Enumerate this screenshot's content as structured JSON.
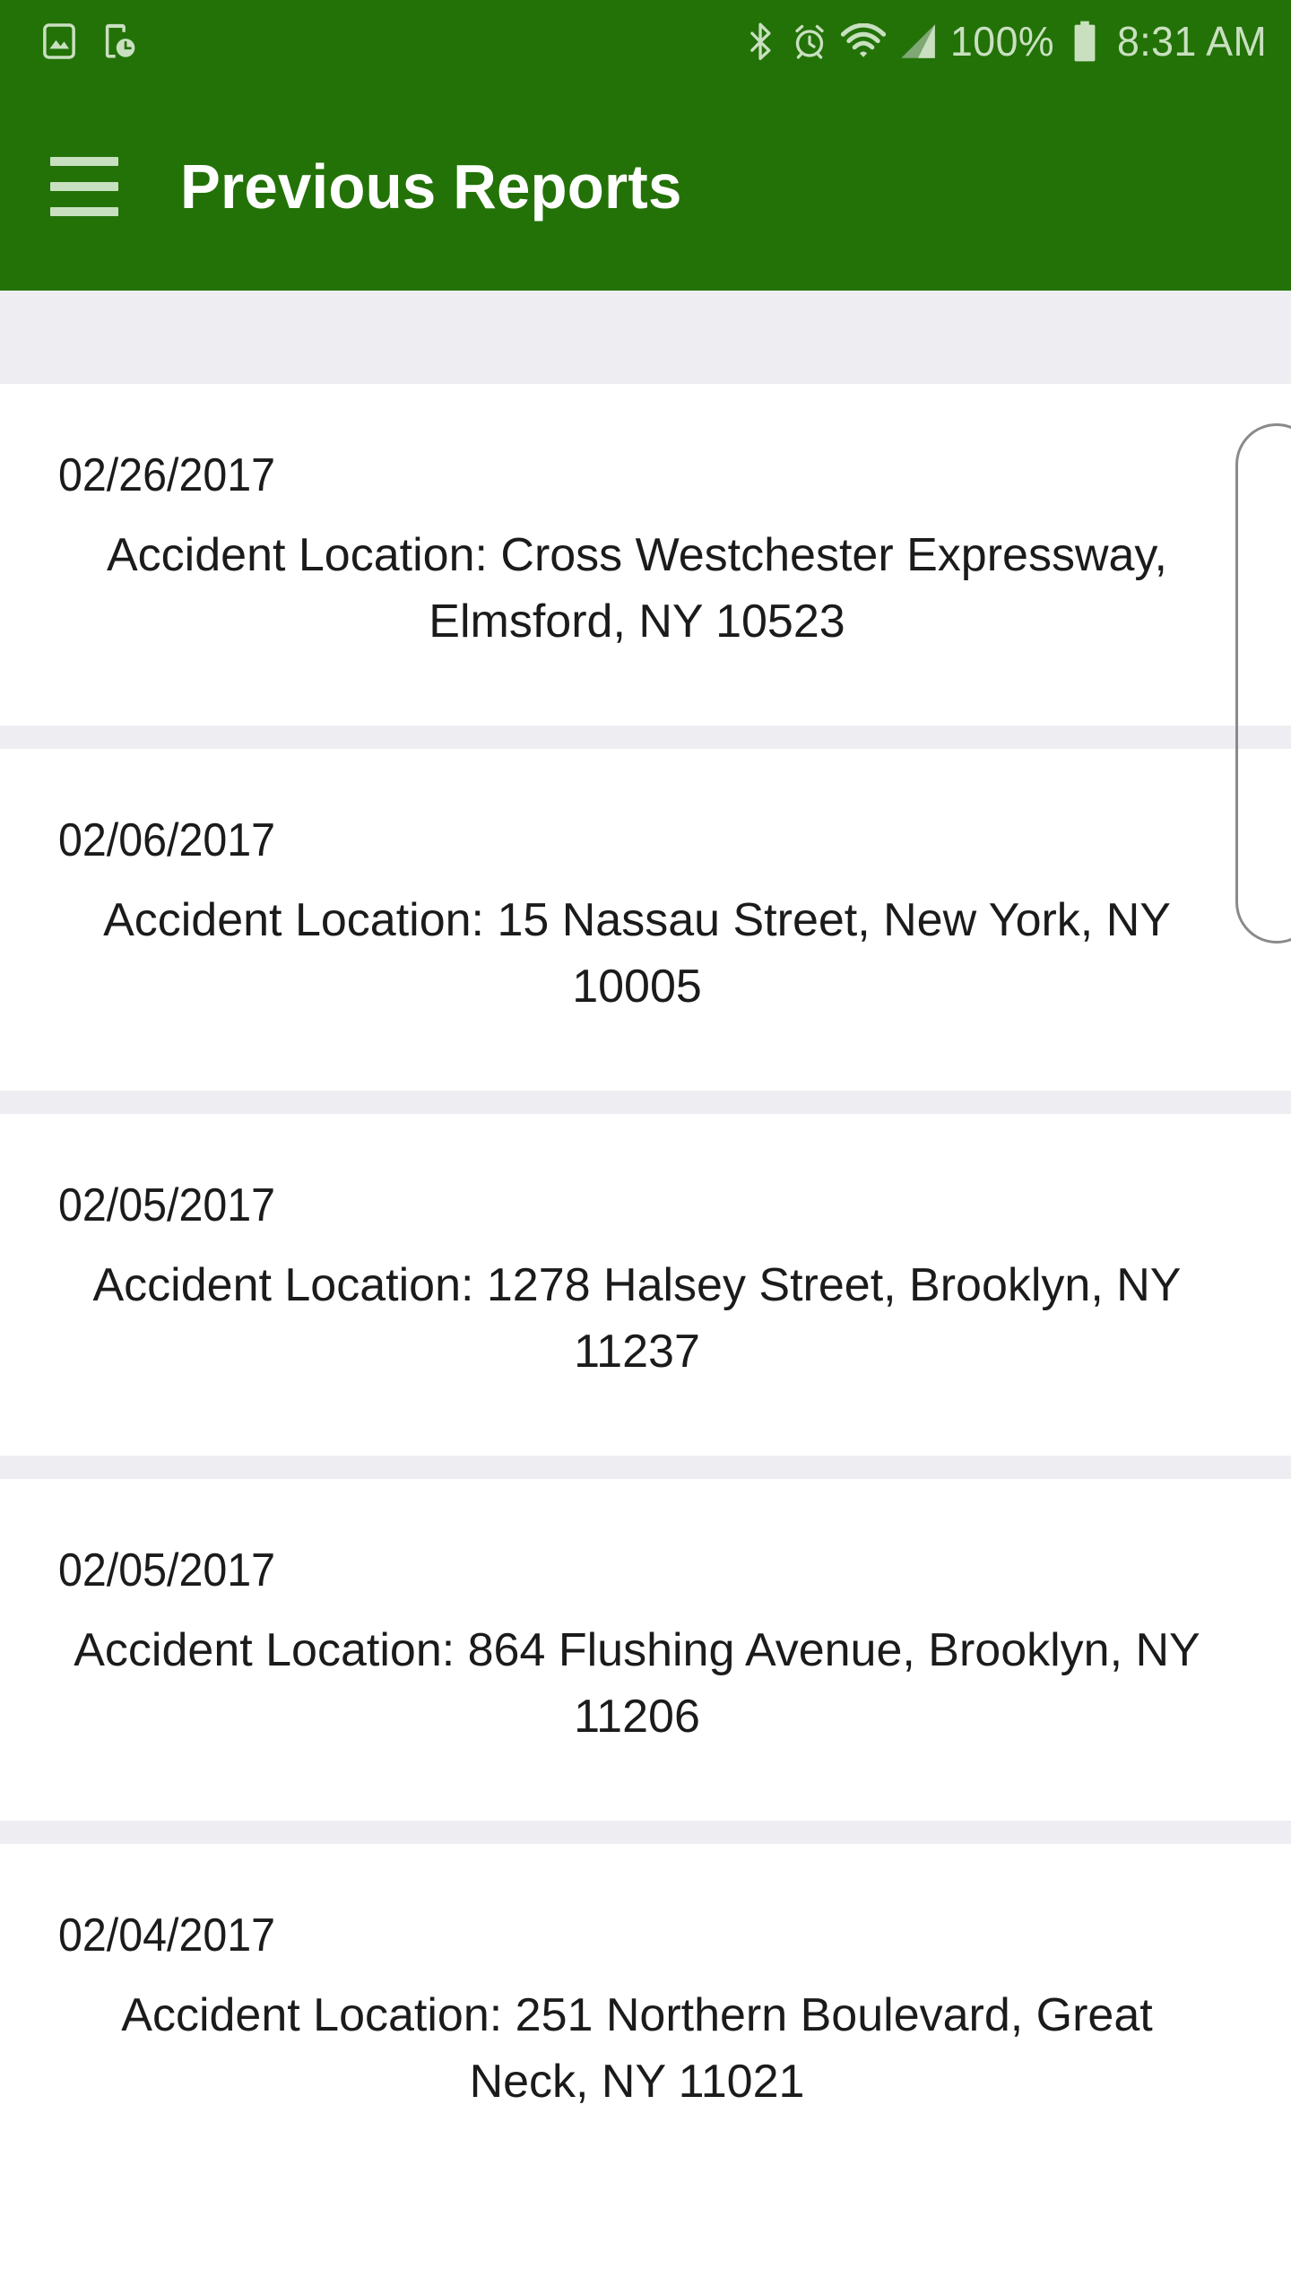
{
  "theme": {
    "app_bar_color": "#237208",
    "status_icon_color": "#C9E0C0",
    "title_color": "#FFFFFF",
    "divider_color": "#EEEEF2",
    "body_text_color": "#1B1B1B",
    "page_background": "#FFFFFF"
  },
  "status_bar": {
    "left_icons": [
      "screenshot-icon",
      "device-clock-icon"
    ],
    "right_icons": [
      "bluetooth-icon",
      "alarm-icon",
      "wifi-icon",
      "cellular-signal-icon"
    ],
    "battery_percent": "100%",
    "battery_state": "full",
    "time": "8:31 AM"
  },
  "app_bar": {
    "menu_icon": "hamburger-menu-icon",
    "title": "Previous Reports"
  },
  "list": {
    "location_label": "Accident Location:",
    "items": [
      {
        "date": "02/26/2017",
        "location": "Cross Westchester Expressway, Elmsford, NY 10523",
        "full_text": "Accident Location: Cross Westchester Expressway, Elmsford, NY 10523"
      },
      {
        "date": "02/06/2017",
        "location": "15 Nassau Street, New York, NY 10005",
        "full_text": "Accident Location: 15 Nassau Street, New York, NY 10005"
      },
      {
        "date": "02/05/2017",
        "location": "1278 Halsey Street, Brooklyn, NY 11237",
        "full_text": "Accident Location: 1278 Halsey Street, Brooklyn, NY 11237"
      },
      {
        "date": "02/05/2017",
        "location": "864 Flushing Avenue, Brooklyn, NY 11206",
        "full_text": "Accident Location: 864 Flushing Avenue, Brooklyn, NY 11206"
      },
      {
        "date": "02/04/2017",
        "location": "251 Northern Boulevard, Great Neck, NY 11021",
        "full_text": "Accident Location: 251 Northern Boulevard, Great Neck, NY 11021"
      }
    ]
  },
  "scrollbar": {
    "name": "vertical-scroll-indicator"
  }
}
